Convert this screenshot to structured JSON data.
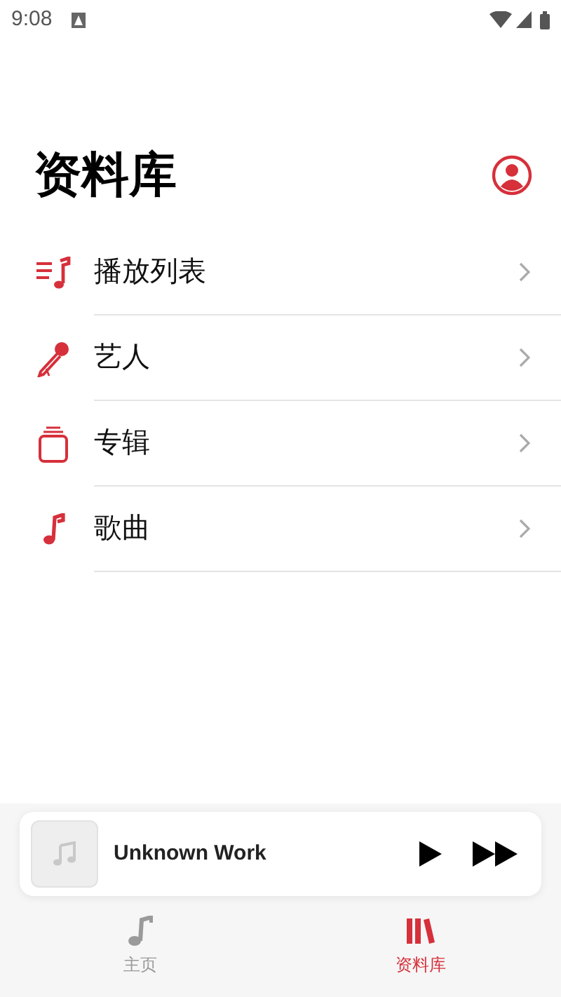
{
  "status_bar": {
    "time": "9:08"
  },
  "header": {
    "title": "资料库"
  },
  "library_items": [
    {
      "kind": "playlists",
      "label": "播放列表"
    },
    {
      "kind": "artists",
      "label": "艺人"
    },
    {
      "kind": "albums",
      "label": "专辑"
    },
    {
      "kind": "songs",
      "label": "歌曲"
    }
  ],
  "mini_player": {
    "title": "Unknown Work"
  },
  "tabs": [
    {
      "kind": "home",
      "label": "主页",
      "selected": false
    },
    {
      "kind": "library",
      "label": "资料库",
      "selected": true
    }
  ]
}
